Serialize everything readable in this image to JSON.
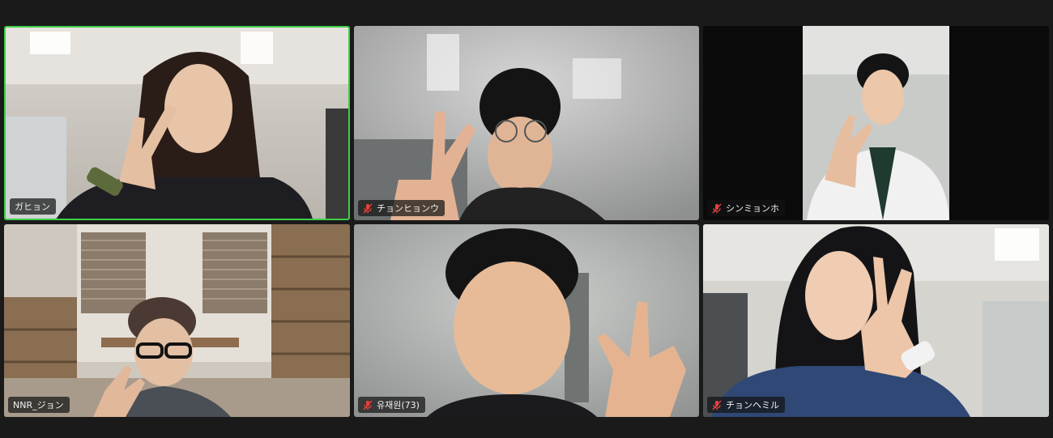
{
  "meeting": {
    "participants": [
      {
        "name": "ガヒョン",
        "muted": false,
        "active_speaker": true
      },
      {
        "name": "チョンヒョンウ",
        "muted": true,
        "active_speaker": false
      },
      {
        "name": "シンミョンホ",
        "muted": true,
        "active_speaker": false
      },
      {
        "name": "NNR_ジョン",
        "muted": false,
        "active_speaker": false
      },
      {
        "name": "유재원(73)",
        "muted": true,
        "active_speaker": false
      },
      {
        "name": "チョンヘミル",
        "muted": true,
        "active_speaker": false
      }
    ]
  },
  "icons": {
    "muted_mic": "mic-muted-icon"
  },
  "colors": {
    "active_speaker_border": "#3ecf4a",
    "muted_icon": "#e5413a",
    "background": "#1a1a1a"
  }
}
